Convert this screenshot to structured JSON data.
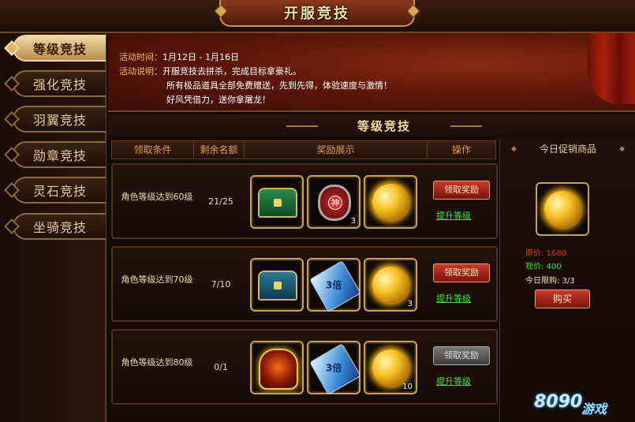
{
  "window": {
    "title": "开服竞技"
  },
  "sidebar": {
    "items": [
      {
        "label": "等级竞技",
        "active": true
      },
      {
        "label": "强化竞技",
        "active": false
      },
      {
        "label": "羽翼竞技",
        "active": false
      },
      {
        "label": "勋章竞技",
        "active": false
      },
      {
        "label": "灵石竞技",
        "active": false
      },
      {
        "label": "坐骑竞技",
        "active": false
      }
    ]
  },
  "description": {
    "time_label": "活动时间：",
    "time_value": "1月12日 - 1月16日",
    "desc_label": "活动说明：",
    "desc_line1": "开服竞技去拼杀，完成目标拿豪礼。",
    "desc_line2": "所有极品道具全部免费赠送，先到先得，体验速度与激情！",
    "desc_line3": "好风凭借力，送你拿屠龙！"
  },
  "section": {
    "title": "等级竞技"
  },
  "table": {
    "headers": [
      "领取条件",
      "剩余名额",
      "奖励展示",
      "操作"
    ],
    "rows": [
      {
        "condition": "角色等级达到60级",
        "remaining": "21/25",
        "rewards": [
          {
            "icon": "green-chest-icon",
            "qty": ""
          },
          {
            "icon": "god-badge-icon",
            "qty": "3"
          },
          {
            "icon": "golden-orb-icon",
            "qty": ""
          }
        ],
        "claim_label": "领取奖励",
        "claim_enabled": true,
        "upgrade_label": "提升等级"
      },
      {
        "condition": "角色等级达到70级",
        "remaining": "7/10",
        "rewards": [
          {
            "icon": "blue-chest-icon",
            "qty": ""
          },
          {
            "icon": "triple-ticket-icon",
            "qty": ""
          },
          {
            "icon": "golden-orb-icon",
            "qty": "3"
          }
        ],
        "claim_label": "领取奖励",
        "claim_enabled": true,
        "upgrade_label": "提升等级"
      },
      {
        "condition": "角色等级达到80级",
        "remaining": "0/1",
        "rewards": [
          {
            "icon": "golden-armor-icon",
            "qty": ""
          },
          {
            "icon": "triple-ticket-icon",
            "qty": ""
          },
          {
            "icon": "golden-orb-icon",
            "qty": "10"
          }
        ],
        "claim_label": "领取奖励",
        "claim_enabled": false,
        "upgrade_label": "提升等级"
      }
    ]
  },
  "promo": {
    "title": "今日促销商品",
    "item_icon": "golden-orb-icon",
    "original_price": "原价: 1680",
    "current_price": "现价: 400",
    "limit": "今日限购: 3/3",
    "buy_label": "购买"
  },
  "logo": {
    "number": "8090",
    "brand": "游戏"
  },
  "colors": {
    "accent_gold": "#f3c24a",
    "claim_red": "#c63a2a",
    "link_green": "#3ee63e",
    "price_red": "#e23a2a"
  }
}
